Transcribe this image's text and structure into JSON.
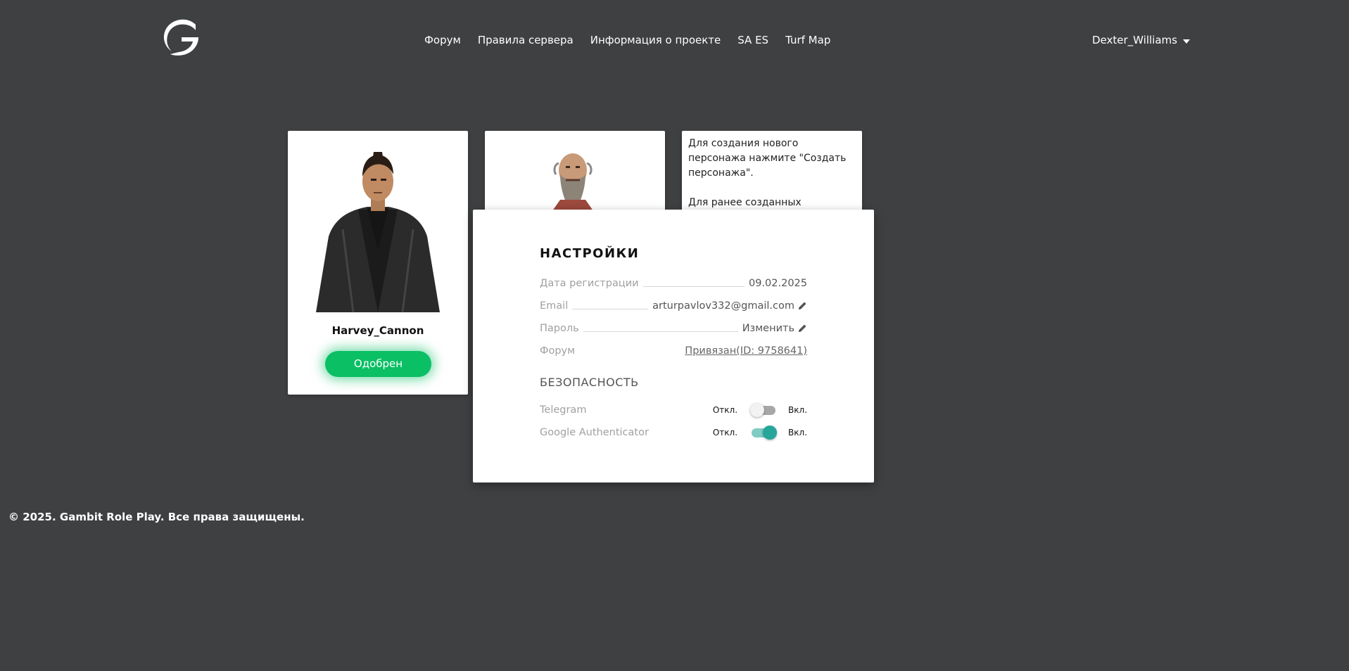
{
  "header": {
    "logo_icon": "gambit-logo-icon",
    "nav": [
      {
        "label": "Форум"
      },
      {
        "label": "Правила сервера"
      },
      {
        "label": "Информация о проекте"
      },
      {
        "label": "SA ES"
      },
      {
        "label": "Turf Map"
      }
    ],
    "user": {
      "name": "Dexter_Williams",
      "icon": "chevron-down-icon"
    }
  },
  "characters": [
    {
      "name": "Harvey_Cannon",
      "status": "Одобрен",
      "status_color": "#0abf64"
    }
  ],
  "info_card": {
    "line1": "Для создания нового персонажа нажмите \"Создать персонажа\".",
    "line2": "Для ранее созданных персонажей нажмите \"Добавить персонажа\"."
  },
  "settings": {
    "title": "НАСТРОЙКИ",
    "rows": {
      "reg_date": {
        "label": "Дата регистрации",
        "value": "09.02.2025"
      },
      "email": {
        "label": "Email",
        "value": "arturpavlov332@gmail.com",
        "icon": "pencil-icon"
      },
      "password": {
        "label": "Пароль",
        "value": "Изменить",
        "icon": "pencil-icon"
      },
      "forum": {
        "label": "Форум",
        "value": "Привязан(ID: 9758641)"
      }
    },
    "security_title": "БЕЗОПАСНОСТЬ",
    "toggles": {
      "telegram": {
        "label": "Telegram",
        "off_label": "Откл.",
        "on_label": "Вкл.",
        "enabled": false
      },
      "google_auth": {
        "label": "Google Authenticator",
        "off_label": "Откл.",
        "on_label": "Вкл.",
        "enabled": true
      }
    },
    "accent_color": "#26a69a"
  },
  "footer": {
    "text": "© 2025. Gambit Role Play. Все права защищены."
  }
}
